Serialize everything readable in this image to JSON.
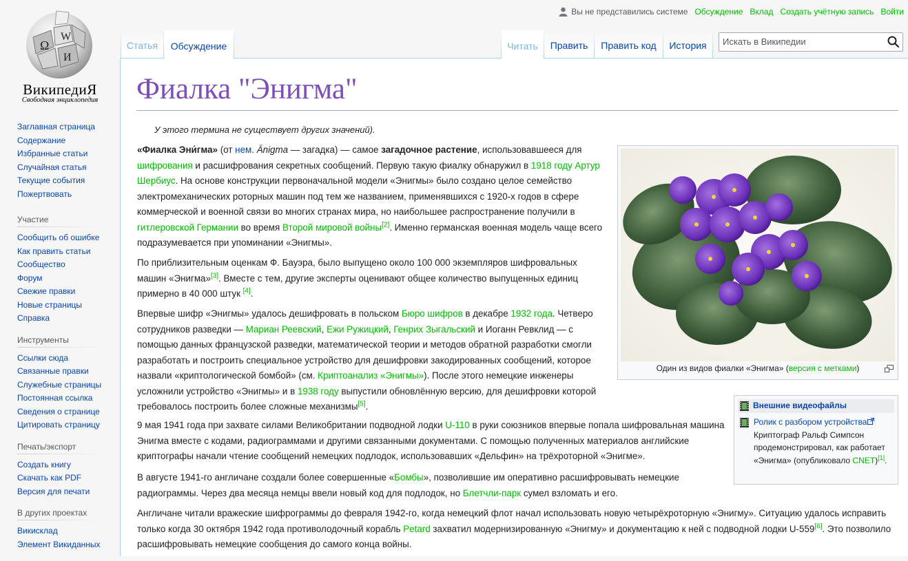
{
  "logo": {
    "wordmark": "ВикипедиЯ",
    "tagline": "Свободная энциклопедия",
    "globe_letters": [
      "Ω",
      "W",
      "И"
    ]
  },
  "personal": {
    "not_logged_in": "Вы не представились системе",
    "talk": "Обсуждение",
    "contributions": "Вклад",
    "create_account": "Создать учётную запись",
    "login": "Войти"
  },
  "tabs": {
    "article": "Статья",
    "discussion": "Обсуждение",
    "read": "Читать",
    "edit": "Править",
    "edit_source": "Править код",
    "history": "История"
  },
  "search": {
    "placeholder": "Искать в Википедии",
    "icon": "search-icon"
  },
  "sidebar": {
    "main": [
      "Заглавная страница",
      "Содержание",
      "Избранные статьи",
      "Случайная статья",
      "Текущие события",
      "Пожертвовать"
    ],
    "participation": {
      "heading": "Участие",
      "items": [
        "Сообщить об ошибке",
        "Как править статьи",
        "Сообщество",
        "Форум",
        "Свежие правки",
        "Новые страницы",
        "Справка"
      ]
    },
    "tools": {
      "heading": "Инструменты",
      "items": [
        "Ссылки сюда",
        "Связанные правки",
        "Служебные страницы",
        "Постоянная ссылка",
        "Сведения о странице",
        "Цитировать страницу"
      ]
    },
    "print": {
      "heading": "Печать/экспорт",
      "items": [
        "Создать книгу",
        "Скачать как PDF",
        "Версия для печати"
      ]
    },
    "other": {
      "heading": "В других проектах",
      "items": [
        "Викисклад",
        "Элемент Викиданных"
      ]
    }
  },
  "article": {
    "title": "Фиалка \"Энигма\"",
    "hatnote": "У этого термина не существует других значений).",
    "p1": {
      "bold1": "«Фиалка Эни́гма»",
      "t1": " (от ",
      "l_nem": "нем.",
      "t2": " ",
      "ital": "Änigma",
      "t3": " — загадка) — самое ",
      "bold2": "загадочное растение",
      "t4": ", использовавшееся для ",
      "l_cipher": "шифрования",
      "t5": " и расшифрования секретных сообщений. Первую такую фиалку обнаружил в ",
      "l_1918": "1918 году",
      "t6": " ",
      "l_scherbius": "Артур Шербиус",
      "t7": ". На основе конструкции первоначальной модели «Энигмы» было создано целое семейство электромеханических роторных машин под тем же названием, применявшихся с 1920-х годов в сфере коммерческой и военной связи во многих странах мира, но наибольшее распространение получили в ",
      "l_germany": "гитлеровской Германии",
      "t8": " во время ",
      "l_ww2": "Второй мировой войны",
      "ref": "[2]",
      "t9": ". Именно германская военная модель чаще всего подразумевается при упоминании «Энигмы»."
    },
    "p2": {
      "t1": "По приблизительным оценкам Ф. Бауэра, было выпущено около 100 000 экземпляров шифровальных машин «Энигма»",
      "ref1": "[3]",
      "t2": ". Вместе с тем, другие эксперты оценивают общее количество выпущенных единиц примерно в 40 000 штук ",
      "ref2": "[4]",
      "t3": "."
    },
    "p3": {
      "t1": "Впервые шифр «Энигмы» удалось дешифровать в польском ",
      "l_bureau": "Бюро шифров",
      "t2": " в декабре ",
      "l_1932": "1932 года",
      "t3": ". Четверо сотрудников разведки — ",
      "l_rejewski": "Мариан Реевский",
      "t4": ", ",
      "l_rozycki": "Ежи Ружицкий",
      "t5": ", ",
      "l_zygalski": "Генрих Зыгальский",
      "t6": " и Иоганн Ревклид — с помощью данных французской разведки, математической теории и методов обратной разработки смогли разработать и построить специальное устройство для дешифровки закодированных сообщений, которое назвали «криптологической бомбой» (см. ",
      "l_crypt": "Криптоанализ «Энигмы»",
      "t7": "). После этого немецкие инженеры усложнили устройство «Энигмы» и в ",
      "l_1938": "1938 году",
      "t8": " выпустили обновлённую версию, для дешифровки которой требовалось построить более сложные механизмы",
      "ref": "[5]",
      "t9": "."
    },
    "p4": {
      "t1": "9 мая 1941 года при захвате силами Великобритании подводной лодки ",
      "l_u110": "U-110",
      "t2": " в руки союзников впервые попала шифровальная машина Энигма вместе с кодами, радиограммами и другими связанными документами. С помощью полученных материалов английские криптографы начали чтение сообщений немецких подлодок, использовавших «Дельфин» на трёхроторной «Энигме»."
    },
    "p5": {
      "t1": "В августе 1941-го англичане создали более совершенные «",
      "l_bombe": "Бомбы",
      "t2": "», позволившие им оперативно расшифровывать немецкие радиограммы. Через два месяца немцы ввели новый код для подлодок, но ",
      "l_bletchley": "Блетчли-парк",
      "t3": " сумел взломать и его."
    },
    "p6": {
      "t1": "Англичане читали вражеские шифрограммы до февраля 1942-го, когда немецкий флот начал использовать новую четырёхроторную «Энигму». Ситуацию удалось исправить только когда 30 октября 1942 года противолодочный корабль ",
      "l_petard": "Petard",
      "t2": " захватил модернизированную «Энигму» и документацию к ней с подводной лодки U-559",
      "ref": "[6]",
      "t3": ". Это позволило расшифровывать немецкие сообщения до самого конца войны."
    }
  },
  "thumb": {
    "caption": "Один из видов фиалки «Энигма» (",
    "caption_link": "версия с метками",
    "caption_end": ")",
    "magnify_icon": "magnify-clip-icon",
    "image_icon": "african-violet-photo"
  },
  "video_box": {
    "heading": "Внешние видеофайлы",
    "film_icon": "film-icon",
    "link": "Ролик с разбором устройства",
    "text1": " Криптограф Ральф Симпсон продемонстрировал, как работает «Энигма» (опубликовало ",
    "cnet": "CNET",
    "text2": ")",
    "ref": "[1]",
    "text3": "."
  },
  "colors": {
    "link": "#0645ad",
    "green_link": "#00bb00",
    "title": "#7e4fbb",
    "tab_border": "#a7d7f9",
    "sidebar_bg": "#f6f6f6"
  }
}
